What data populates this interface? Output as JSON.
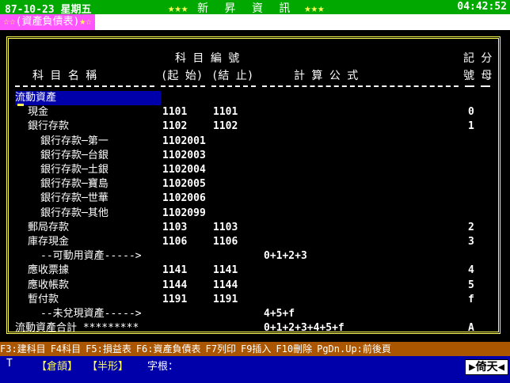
{
  "topbar": {
    "date": "87-10-23 星期五",
    "brand": "新 昇 資 訊",
    "time": "04:42:52",
    "stars_left": "★★★",
    "stars_right": "★★★"
  },
  "title": {
    "stars_left": "☆☆",
    "text": "(資產負債表)",
    "stars_right": "★☆"
  },
  "headers": {
    "name": "科 目 名 稱",
    "code_group": "科 目 編 號",
    "start": "(起 始)",
    "end": "(結 止)",
    "formula": "計 算 公 式",
    "class_top": "記 分",
    "class_bot": "號 母"
  },
  "rows": [
    {
      "name": "流動資產",
      "start": "",
      "end": "",
      "formula": "",
      "code": "",
      "indent": 0,
      "selected": true
    },
    {
      "name": "現金",
      "start": "1101",
      "end": "1101",
      "formula": "",
      "code": "0",
      "indent": 1
    },
    {
      "name": "銀行存款",
      "start": "1102",
      "end": "1102",
      "formula": "",
      "code": "1",
      "indent": 1
    },
    {
      "name": "銀行存款─第一",
      "start": "1102001",
      "end": "",
      "formula": "",
      "code": "",
      "indent": 2
    },
    {
      "name": "銀行存款─台銀",
      "start": "1102003",
      "end": "",
      "formula": "",
      "code": "",
      "indent": 2
    },
    {
      "name": "銀行存款─土銀",
      "start": "1102004",
      "end": "",
      "formula": "",
      "code": "",
      "indent": 2
    },
    {
      "name": "銀行存款─寶島",
      "start": "1102005",
      "end": "",
      "formula": "",
      "code": "",
      "indent": 2
    },
    {
      "name": "銀行存款─世華",
      "start": "1102006",
      "end": "",
      "formula": "",
      "code": "",
      "indent": 2
    },
    {
      "name": "銀行存款─其他",
      "start": "1102099",
      "end": "",
      "formula": "",
      "code": "",
      "indent": 2
    },
    {
      "name": "郵局存款",
      "start": "1103",
      "end": "1103",
      "formula": "",
      "code": "2",
      "indent": 1
    },
    {
      "name": "庫存現金",
      "start": "1106",
      "end": "1106",
      "formula": "",
      "code": "3",
      "indent": 1
    },
    {
      "name": "--可動用資產----->",
      "start": "",
      "end": "",
      "formula": "0+1+2+3",
      "code": "",
      "indent": 2
    },
    {
      "name": "應收票據",
      "start": "1141",
      "end": "1141",
      "formula": "",
      "code": "4",
      "indent": 1
    },
    {
      "name": "應收帳款",
      "start": "1144",
      "end": "1144",
      "formula": "",
      "code": "5",
      "indent": 1
    },
    {
      "name": "暫付款",
      "start": "1191",
      "end": "1191",
      "formula": "",
      "code": "f",
      "indent": 1
    },
    {
      "name": "--未兌現資產----->",
      "start": "",
      "end": "",
      "formula": "4+5+f",
      "code": "",
      "indent": 2
    },
    {
      "name": "流動資產合計 *********",
      "start": "",
      "end": "",
      "formula": "0+1+2+3+4+5+f",
      "code": "A",
      "indent": 0
    }
  ],
  "fkeys": [
    "F3:建科目",
    "F4科目",
    "F5:損益表",
    "F6:資產負債表",
    "F7列印",
    "F9插入",
    "F10刪除",
    "PgDn.Up:前後頁"
  ],
  "status": {
    "mode": "T",
    "ime": "【倉頡】",
    "width": "【半形】",
    "root_label": "字根：",
    "brand": "▶倚天◀"
  }
}
